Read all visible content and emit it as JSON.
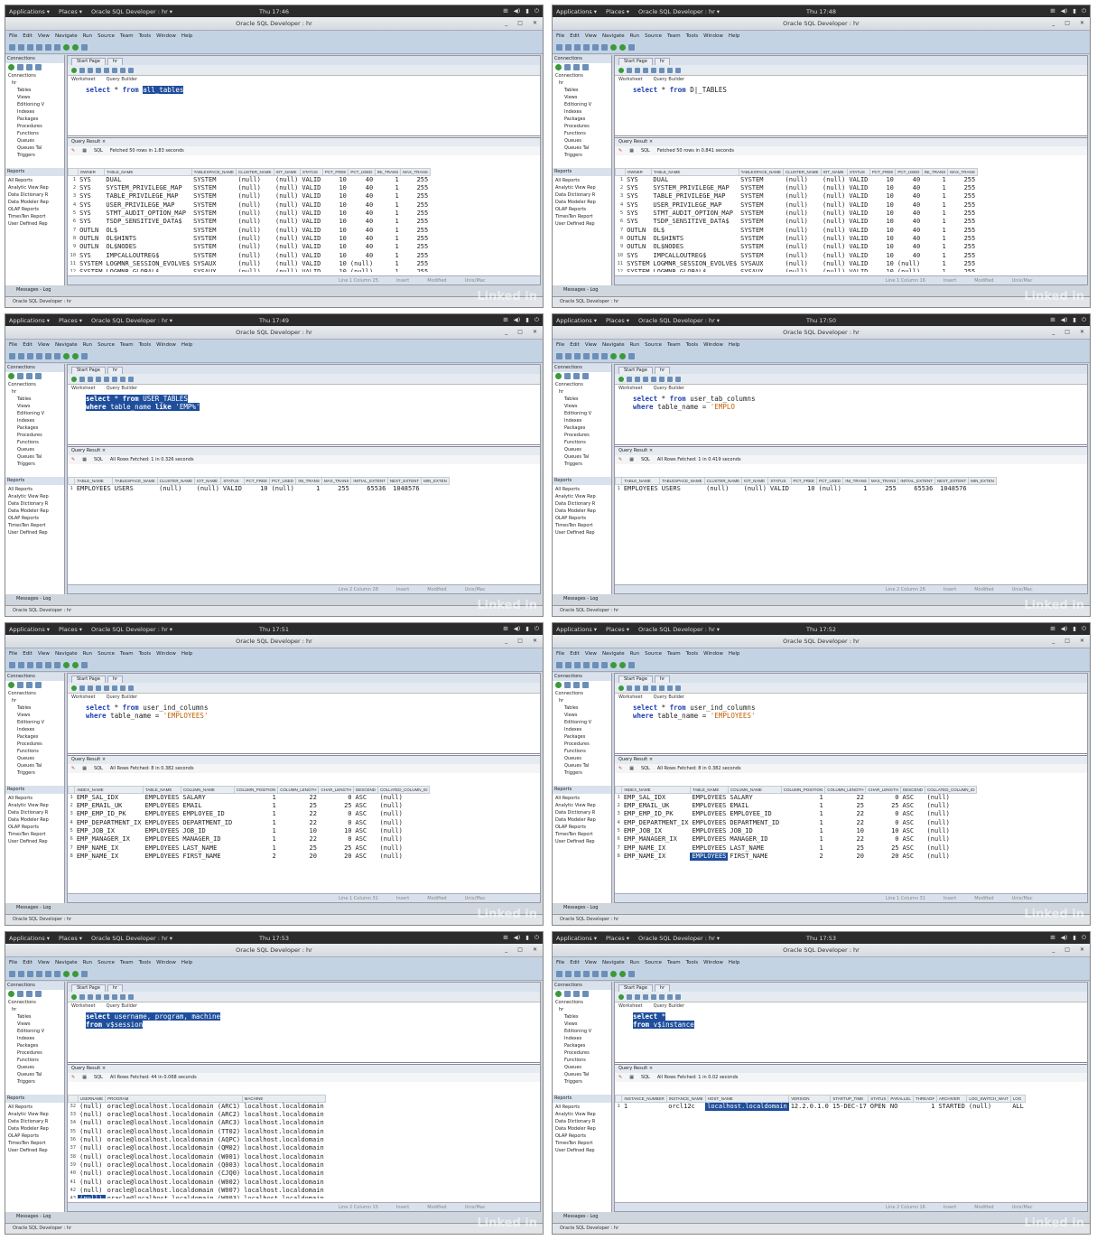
{
  "menu": [
    "File",
    "Edit",
    "View",
    "Navigate",
    "Run",
    "Source",
    "Team",
    "Tools",
    "Window",
    "Help"
  ],
  "tree": [
    "Tables",
    "Views",
    "Editioning V",
    "Indexes",
    "Packages",
    "Procedures",
    "Functions",
    "Queues",
    "Queues Tal",
    "Triggers"
  ],
  "reports": [
    "All Reports",
    "Analytic View Rep",
    "Data Dictionary R",
    "Data Modeler Rep",
    "OLAP Reports",
    "TimesTen Report",
    "User Defined Rep"
  ],
  "common": {
    "apps": "Applications ▾",
    "places": "Places ▾",
    "app": "Oracle SQL Developer : hr ▾",
    "title": "Oracle SQL Developer : hr",
    "connections": "Connections",
    "connections_node": "Connections",
    "hr_node": "hr",
    "reports": "Reports",
    "start_page": "Start Page",
    "hr_tab": "hr",
    "worksheet": "Worksheet",
    "query_builder": "Query Builder",
    "query_result": "Query Result ×",
    "sql": "SQL",
    "messages": "Messages - Log",
    "taskbar": "Oracle SQL Developer : hr",
    "watermark": "Linked in",
    "status_insert": "Insert",
    "status_modified": "Modified",
    "status_unix": "Unix/Mac"
  },
  "panes": [
    {
      "time": "Thu 17:46",
      "sql": [
        [
          {
            "t": "select",
            "c": "kw"
          },
          {
            "t": " * "
          },
          {
            "t": "from",
            "c": "kw"
          },
          {
            "t": " "
          },
          {
            "t": "all_tables",
            "c": "sel"
          }
        ]
      ],
      "status": "Fetched 50 rows in 1.83 seconds",
      "line": "Line 1 Column 25",
      "cols": [
        "",
        "OWNER",
        "TABLE_NAME",
        "TABLESPACE_NAME",
        "CLUSTER_NAME",
        "IOT_NAME",
        "STATUS",
        "PCT_FREE",
        "PCT_USED",
        "INI_TRANS",
        "MAX_TRANS"
      ],
      "rows": [
        [
          "1",
          "SYS",
          "DUAL",
          "SYSTEM",
          "(null)",
          "(null)",
          "VALID",
          "10",
          "40",
          "1",
          "255"
        ],
        [
          "2",
          "SYS",
          "SYSTEM_PRIVILEGE_MAP",
          "SYSTEM",
          "(null)",
          "(null)",
          "VALID",
          "10",
          "40",
          "1",
          "255"
        ],
        [
          "3",
          "SYS",
          "TABLE_PRIVILEGE_MAP",
          "SYSTEM",
          "(null)",
          "(null)",
          "VALID",
          "10",
          "40",
          "1",
          "255"
        ],
        [
          "4",
          "SYS",
          "USER_PRIVILEGE_MAP",
          "SYSTEM",
          "(null)",
          "(null)",
          "VALID",
          "10",
          "40",
          "1",
          "255"
        ],
        [
          "5",
          "SYS",
          "STMT_AUDIT_OPTION_MAP",
          "SYSTEM",
          "(null)",
          "(null)",
          "VALID",
          "10",
          "40",
          "1",
          "255"
        ],
        [
          "6",
          "SYS",
          "TSDP_SENSITIVE_DATA$",
          "SYSTEM",
          "(null)",
          "(null)",
          "VALID",
          "10",
          "40",
          "1",
          "255"
        ],
        [
          "7",
          "OUTLN",
          "OL$",
          "SYSTEM",
          "(null)",
          "(null)",
          "VALID",
          "10",
          "40",
          "1",
          "255"
        ],
        [
          "8",
          "OUTLN",
          "OL$HINTS",
          "SYSTEM",
          "(null)",
          "(null)",
          "VALID",
          "10",
          "40",
          "1",
          "255"
        ],
        [
          "9",
          "OUTLN",
          "OL$NODES",
          "SYSTEM",
          "(null)",
          "(null)",
          "VALID",
          "10",
          "40",
          "1",
          "255"
        ],
        [
          "10",
          "SYS",
          "IMPCALLOUTREG$",
          "SYSTEM",
          "(null)",
          "(null)",
          "VALID",
          "10",
          "40",
          "1",
          "255"
        ],
        [
          "11",
          "SYSTEM",
          "LOGMNR_SESSION_EVOLVE$",
          "SYSAUX",
          "(null)",
          "(null)",
          "VALID",
          "10",
          "(null)",
          "1",
          "255"
        ],
        [
          "12",
          "SYSTEM",
          "LOGMNR_GLOBAL$",
          "SYSAUX",
          "(null)",
          "(null)",
          "VALID",
          "10",
          "(null)",
          "1",
          "255"
        ]
      ]
    },
    {
      "time": "Thu 17:48",
      "sql": [
        [
          {
            "t": "select",
            "c": "kw"
          },
          {
            "t": " * "
          },
          {
            "t": "from",
            "c": "kw"
          },
          {
            "t": " D|_TABLES"
          }
        ]
      ],
      "status": "Fetched 50 rows in 0.841 seconds",
      "line": "Line 1 Column 16",
      "cols": [
        "",
        "OWNER",
        "TABLE_NAME",
        "TABLESPACE_NAME",
        "CLUSTER_NAME",
        "IOT_NAME",
        "STATUS",
        "PCT_FREE",
        "PCT_USED",
        "INI_TRANS",
        "MAX_TRANS"
      ],
      "rows": [
        [
          "1",
          "SYS",
          "DUAL",
          "SYSTEM",
          "(null)",
          "(null)",
          "VALID",
          "10",
          "40",
          "1",
          "255"
        ],
        [
          "2",
          "SYS",
          "SYSTEM_PRIVILEGE_MAP",
          "SYSTEM",
          "(null)",
          "(null)",
          "VALID",
          "10",
          "40",
          "1",
          "255"
        ],
        [
          "3",
          "SYS",
          "TABLE_PRIVILEGE_MAP",
          "SYSTEM",
          "(null)",
          "(null)",
          "VALID",
          "10",
          "40",
          "1",
          "255"
        ],
        [
          "4",
          "SYS",
          "USER_PRIVILEGE_MAP",
          "SYSTEM",
          "(null)",
          "(null)",
          "VALID",
          "10",
          "40",
          "1",
          "255"
        ],
        [
          "5",
          "SYS",
          "STMT_AUDIT_OPTION_MAP",
          "SYSTEM",
          "(null)",
          "(null)",
          "VALID",
          "10",
          "40",
          "1",
          "255"
        ],
        [
          "6",
          "SYS",
          "TSDP_SENSITIVE_DATA$",
          "SYSTEM",
          "(null)",
          "(null)",
          "VALID",
          "10",
          "40",
          "1",
          "255"
        ],
        [
          "7",
          "OUTLN",
          "OL$",
          "SYSTEM",
          "(null)",
          "(null)",
          "VALID",
          "10",
          "40",
          "1",
          "255"
        ],
        [
          "8",
          "OUTLN",
          "OL$HINTS",
          "SYSTEM",
          "(null)",
          "(null)",
          "VALID",
          "10",
          "40",
          "1",
          "255"
        ],
        [
          "9",
          "OUTLN",
          "OL$NODES",
          "SYSTEM",
          "(null)",
          "(null)",
          "VALID",
          "10",
          "40",
          "1",
          "255"
        ],
        [
          "10",
          "SYS",
          "IMPCALLOUTREG$",
          "SYSTEM",
          "(null)",
          "(null)",
          "VALID",
          "10",
          "40",
          "1",
          "255"
        ],
        [
          "11",
          "SYSTEM",
          "LOGMNR_SESSION_EVOLVE$",
          "SYSAUX",
          "(null)",
          "(null)",
          "VALID",
          "10",
          "(null)",
          "1",
          "255"
        ],
        [
          "12",
          "SYSTEM",
          "LOGMNR_GLOBAL$",
          "SYSAUX",
          "(null)",
          "(null)",
          "VALID",
          "10",
          "(null)",
          "1",
          "255"
        ]
      ]
    },
    {
      "time": "Thu 17:49",
      "sql": [
        [
          {
            "t": "select",
            "c": "kw sel"
          },
          {
            "t": " * ",
            "c": "sel"
          },
          {
            "t": "from",
            "c": "kw sel"
          },
          {
            "t": " USER_TABLES",
            "c": "sel"
          }
        ],
        [
          {
            "t": "where",
            "c": "kw sel"
          },
          {
            "t": " table_name ",
            "c": "sel"
          },
          {
            "t": "like",
            "c": "kw sel"
          },
          {
            "t": " 'EMP%'",
            "c": "str sel"
          }
        ]
      ],
      "status": "All Rows Fetched: 1 in 0.326 seconds",
      "line": "Line 2 Column 28",
      "cols": [
        "",
        "TABLE_NAME",
        "TABLESPACE_NAME",
        "CLUSTER_NAME",
        "IOT_NAME",
        "STATUS",
        "PCT_FREE",
        "PCT_USED",
        "INI_TRANS",
        "MAX_TRANS",
        "INITIAL_EXTENT",
        "NEXT_EXTENT",
        "MIN_EXTEN"
      ],
      "rows": [
        [
          "1",
          "EMPLOYEES",
          "USERS",
          "(null)",
          "(null)",
          "VALID",
          "10",
          "(null)",
          "1",
          "255",
          "65536",
          "1048576",
          ""
        ]
      ]
    },
    {
      "time": "Thu 17:50",
      "sql": [
        [
          {
            "t": "select",
            "c": "kw"
          },
          {
            "t": " * "
          },
          {
            "t": "from",
            "c": "kw"
          },
          {
            "t": " user_tab_columns"
          }
        ],
        [
          {
            "t": "where",
            "c": "kw"
          },
          {
            "t": " table_name = "
          },
          {
            "t": "'EMPLO",
            "c": "str"
          }
        ]
      ],
      "status": "All Rows Fetched: 1 in 0.419 seconds",
      "line": "Line 2 Column 26",
      "cols": [
        "",
        "TABLE_NAME",
        "TABLESPACE_NAME",
        "CLUSTER_NAME",
        "IOT_NAME",
        "STATUS",
        "PCT_FREE",
        "PCT_USED",
        "INI_TRANS",
        "MAX_TRANS",
        "INITIAL_EXTENT",
        "NEXT_EXTENT",
        "MIN_EXTEN"
      ],
      "rows": [
        [
          "1",
          "EMPLOYEES",
          "USERS",
          "(null)",
          "(null)",
          "VALID",
          "10",
          "(null)",
          "1",
          "255",
          "65536",
          "1048576",
          ""
        ]
      ]
    },
    {
      "time": "Thu 17:51",
      "sql": [
        [
          {
            "t": "select",
            "c": "kw"
          },
          {
            "t": " * "
          },
          {
            "t": "from",
            "c": "kw"
          },
          {
            "t": " user_ind_columns"
          }
        ],
        [
          {
            "t": "where",
            "c": "kw"
          },
          {
            "t": " table_name = "
          },
          {
            "t": "'EMPLOYEES'",
            "c": "str"
          }
        ]
      ],
      "status": "All Rows Fetched: 8 in 0.382 seconds",
      "line": "Line 1 Column 31",
      "cols": [
        "",
        "INDEX_NAME",
        "TABLE_NAME",
        "COLUMN_NAME",
        "COLUMN_POSITION",
        "COLUMN_LENGTH",
        "CHAR_LENGTH",
        "DESCEND",
        "COLLATED_COLUMN_ID"
      ],
      "rows": [
        [
          "1",
          "EMP_SAL_IDX",
          "EMPLOYEES",
          "SALARY",
          "1",
          "22",
          "0",
          "ASC",
          "(null)"
        ],
        [
          "2",
          "EMP_EMAIL_UK",
          "EMPLOYEES",
          "EMAIL",
          "1",
          "25",
          "25",
          "ASC",
          "(null)"
        ],
        [
          "3",
          "EMP_EMP_ID_PK",
          "EMPLOYEES",
          "EMPLOYEE_ID",
          "1",
          "22",
          "0",
          "ASC",
          "(null)"
        ],
        [
          "4",
          "EMP_DEPARTMENT_IX",
          "EMPLOYEES",
          "DEPARTMENT_ID",
          "1",
          "22",
          "0",
          "ASC",
          "(null)"
        ],
        [
          "5",
          "EMP_JOB_IX",
          "EMPLOYEES",
          "JOB_ID",
          "1",
          "10",
          "10",
          "ASC",
          "(null)"
        ],
        [
          "6",
          "EMP_MANAGER_IX",
          "EMPLOYEES",
          "MANAGER_ID",
          "1",
          "22",
          "0",
          "ASC",
          "(null)"
        ],
        [
          "7",
          "EMP_NAME_IX",
          "EMPLOYEES",
          "LAST_NAME",
          "1",
          "25",
          "25",
          "ASC",
          "(null)"
        ],
        [
          "8",
          "EMP_NAME_IX",
          "EMPLOYEES",
          "FIRST_NAME",
          "2",
          "20",
          "20",
          "ASC",
          "(null)"
        ]
      ]
    },
    {
      "time": "Thu 17:52",
      "sql": [
        [
          {
            "t": "select",
            "c": "kw"
          },
          {
            "t": " * "
          },
          {
            "t": "from",
            "c": "kw"
          },
          {
            "t": " user_ind_columns"
          }
        ],
        [
          {
            "t": "where",
            "c": "kw"
          },
          {
            "t": " table_name = "
          },
          {
            "t": "'EMPLOYEES'",
            "c": "str"
          }
        ]
      ],
      "status": "All Rows Fetched: 8 in 0.382 seconds",
      "line": "Line 1 Column 31",
      "hlrow": 7,
      "hlcol": 2,
      "cols": [
        "",
        "INDEX_NAME",
        "TABLE_NAME",
        "COLUMN_NAME",
        "COLUMN_POSITION",
        "COLUMN_LENGTH",
        "CHAR_LENGTH",
        "DESCEND",
        "COLLATED_COLUMN_ID"
      ],
      "rows": [
        [
          "1",
          "EMP_SAL_IDX",
          "EMPLOYEES",
          "SALARY",
          "1",
          "22",
          "0",
          "ASC",
          "(null)"
        ],
        [
          "2",
          "EMP_EMAIL_UK",
          "EMPLOYEES",
          "EMAIL",
          "1",
          "25",
          "25",
          "ASC",
          "(null)"
        ],
        [
          "3",
          "EMP_EMP_ID_PK",
          "EMPLOYEES",
          "EMPLOYEE_ID",
          "1",
          "22",
          "0",
          "ASC",
          "(null)"
        ],
        [
          "4",
          "EMP_DEPARTMENT_IX",
          "EMPLOYEES",
          "DEPARTMENT_ID",
          "1",
          "22",
          "0",
          "ASC",
          "(null)"
        ],
        [
          "5",
          "EMP_JOB_IX",
          "EMPLOYEES",
          "JOB_ID",
          "1",
          "10",
          "10",
          "ASC",
          "(null)"
        ],
        [
          "6",
          "EMP_MANAGER_IX",
          "EMPLOYEES",
          "MANAGER_ID",
          "1",
          "22",
          "0",
          "ASC",
          "(null)"
        ],
        [
          "7",
          "EMP_NAME_IX",
          "EMPLOYEES",
          "LAST_NAME",
          "1",
          "25",
          "25",
          "ASC",
          "(null)"
        ],
        [
          "8",
          "EMP_NAME_IX",
          "EMPLOYEES",
          "FIRST_NAME",
          "2",
          "20",
          "20",
          "ASC",
          "(null)"
        ]
      ]
    },
    {
      "time": "Thu 17:53",
      "sql": [
        [
          {
            "t": "select",
            "c": "kw sel"
          },
          {
            "t": " username, program, machine",
            "c": "sel"
          }
        ],
        [
          {
            "t": "from",
            "c": "kw sel"
          },
          {
            "t": " v$session",
            "c": "sel"
          }
        ]
      ],
      "status": "All Rows Fetched: 44 in 0.068 seconds",
      "line": "Line 2 Column 15",
      "hlrow": 11,
      "hlcol": 1,
      "cols": [
        "",
        "USERNAME",
        "PROGRAM",
        "MACHINE"
      ],
      "rows": [
        [
          "32",
          "(null)",
          "oracle@localhost.localdomain (ARC1)",
          "localhost.localdomain"
        ],
        [
          "33",
          "(null)",
          "oracle@localhost.localdomain (ARC2)",
          "localhost.localdomain"
        ],
        [
          "34",
          "(null)",
          "oracle@localhost.localdomain (ARC3)",
          "localhost.localdomain"
        ],
        [
          "35",
          "(null)",
          "oracle@localhost.localdomain (TT02)",
          "localhost.localdomain"
        ],
        [
          "36",
          "(null)",
          "oracle@localhost.localdomain (AQPC)",
          "localhost.localdomain"
        ],
        [
          "37",
          "(null)",
          "oracle@localhost.localdomain (QM02)",
          "localhost.localdomain"
        ],
        [
          "38",
          "(null)",
          "oracle@localhost.localdomain (W001)",
          "localhost.localdomain"
        ],
        [
          "39",
          "(null)",
          "oracle@localhost.localdomain (Q003)",
          "localhost.localdomain"
        ],
        [
          "40",
          "(null)",
          "oracle@localhost.localdomain (CJQ0)",
          "localhost.localdomain"
        ],
        [
          "41",
          "(null)",
          "oracle@localhost.localdomain (W002)",
          "localhost.localdomain"
        ],
        [
          "42",
          "(null)",
          "oracle@localhost.localdomain (W007)",
          "localhost.localdomain"
        ],
        [
          "43",
          "(null)",
          "oracle@localhost.localdomain (W003)",
          "localhost.localdomain"
        ],
        [
          "44",
          "HR",
          "SQL Developer",
          "localhost"
        ]
      ]
    },
    {
      "time": "Thu 17:53",
      "sql": [
        [
          {
            "t": "select",
            "c": "kw sel"
          },
          {
            "t": " *",
            "c": "sel"
          }
        ],
        [
          {
            "t": "from",
            "c": "kw sel"
          },
          {
            "t": " v$instance",
            "c": "sel"
          }
        ]
      ],
      "status": "All Rows Fetched: 1 in 0.02 seconds",
      "line": "Line 2 Column 16",
      "hlrow": 0,
      "hlcol": 3,
      "cols": [
        "",
        "INSTANCE_NUMBER",
        "INSTANCE_NAME",
        "HOST_NAME",
        "VERSION",
        "STARTUP_TIME",
        "STATUS",
        "PARALLEL",
        "THREAD#",
        "ARCHIVER",
        "LOG_SWITCH_WAIT",
        "LOG"
      ],
      "rows": [
        [
          "1",
          "1",
          "orcl12c",
          "localhost.localdomain",
          "12.2.0.1.0",
          "15-DEC-17",
          "OPEN",
          "NO",
          "1",
          "STARTED",
          "(null)",
          "ALL"
        ]
      ]
    }
  ]
}
